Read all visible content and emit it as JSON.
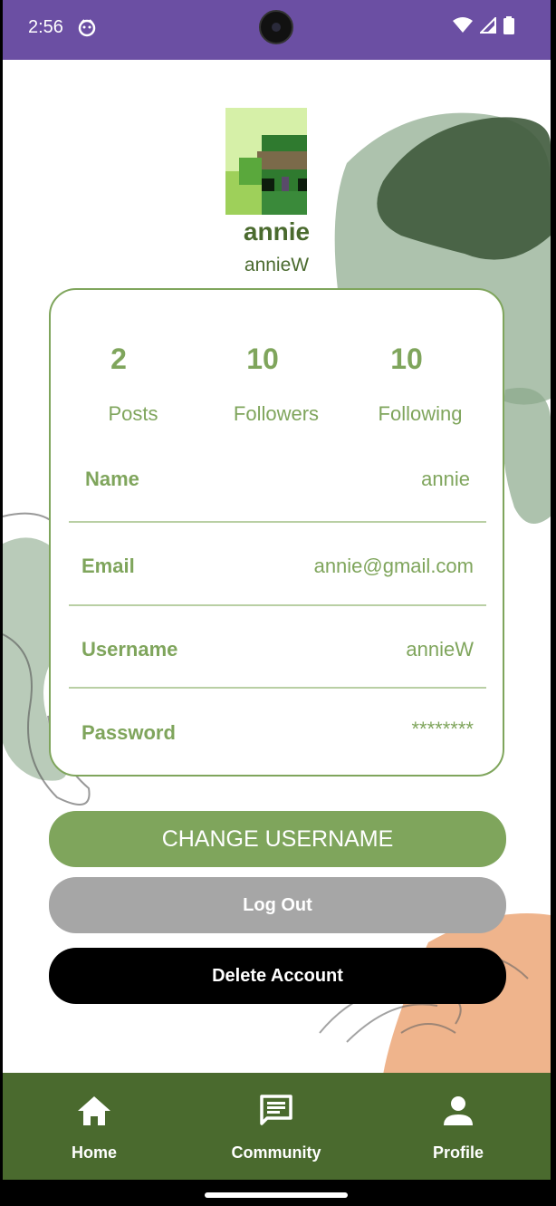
{
  "status_bar": {
    "time": "2:56",
    "color": "#6b4fa3"
  },
  "profile": {
    "display_name": "annie",
    "handle": "annieW"
  },
  "stats": [
    {
      "value": "2",
      "label": "Posts"
    },
    {
      "value": "10",
      "label": "Followers"
    },
    {
      "value": "10",
      "label": "Following"
    }
  ],
  "fields": [
    {
      "label": "Name",
      "value": "annie"
    },
    {
      "label": "Email",
      "value": "annie@gmail.com"
    },
    {
      "label": "Username",
      "value": "annieW"
    },
    {
      "label": "Password",
      "value": "********"
    }
  ],
  "buttons": {
    "change_username": "CHANGE USERNAME",
    "log_out": "Log Out",
    "delete_account": "Delete Account"
  },
  "nav": [
    {
      "label": "Home",
      "icon": "home-icon"
    },
    {
      "label": "Community",
      "icon": "chat-icon"
    },
    {
      "label": "Profile",
      "icon": "person-icon",
      "active": true
    }
  ],
  "colors": {
    "accent": "#7fa55c",
    "dark_green": "#4a6a2e",
    "logout_gray": "#a6a6a6",
    "delete_black": "#000000",
    "deco_orange": "#efb48c"
  }
}
